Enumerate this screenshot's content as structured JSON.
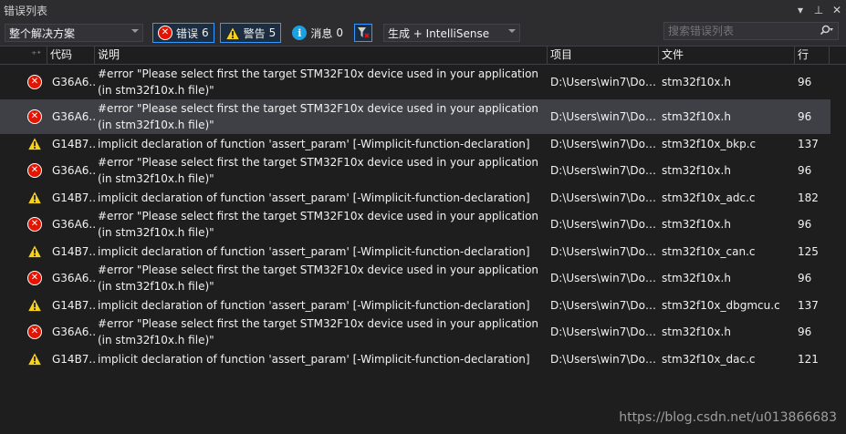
{
  "window": {
    "title": "错误列表",
    "pin_glyph": "▾",
    "pin2_glyph": "⊥",
    "close_glyph": "✕"
  },
  "toolbar": {
    "scope_value": "整个解决方案",
    "errors_label": "错误",
    "errors_count": "6",
    "warnings_label": "警告",
    "warnings_count": "5",
    "messages_label": "消息",
    "messages_count": "0",
    "build_filter_value": "生成 + IntelliSense",
    "search_placeholder": "搜索错误列表"
  },
  "columns": {
    "code": "代码",
    "description": "说明",
    "project": "项目",
    "file": "文件",
    "line": "行"
  },
  "rows": [
    {
      "type": "error",
      "code": "G36A6...",
      "description": "#error \"Please select first the target STM32F10x device used in your application (in stm32f10x.h file)\"",
      "project": "D:\\Users\\win7\\Doc...",
      "file": "stm32f10x.h",
      "line": "96"
    },
    {
      "type": "error",
      "code": "G36A6...",
      "description": "#error \"Please select first the target STM32F10x device used in your application (in stm32f10x.h file)\"",
      "project": "D:\\Users\\win7\\Doc...",
      "file": "stm32f10x.h",
      "line": "96"
    },
    {
      "type": "warning",
      "code": "G14B7...",
      "description": "implicit declaration of function 'assert_param' [-Wimplicit-function-declaration]",
      "project": "D:\\Users\\win7\\Doc...",
      "file": "stm32f10x_bkp.c",
      "line": "137"
    },
    {
      "type": "error",
      "code": "G36A6...",
      "description": "#error \"Please select first the target STM32F10x device used in your application (in stm32f10x.h file)\"",
      "project": "D:\\Users\\win7\\Doc...",
      "file": "stm32f10x.h",
      "line": "96"
    },
    {
      "type": "warning",
      "code": "G14B7...",
      "description": "implicit declaration of function 'assert_param' [-Wimplicit-function-declaration]",
      "project": "D:\\Users\\win7\\Doc...",
      "file": "stm32f10x_adc.c",
      "line": "182"
    },
    {
      "type": "error",
      "code": "G36A6...",
      "description": "#error \"Please select first the target STM32F10x device used in your application (in stm32f10x.h file)\"",
      "project": "D:\\Users\\win7\\Doc...",
      "file": "stm32f10x.h",
      "line": "96"
    },
    {
      "type": "warning",
      "code": "G14B7...",
      "description": "implicit declaration of function 'assert_param' [-Wimplicit-function-declaration]",
      "project": "D:\\Users\\win7\\Doc...",
      "file": "stm32f10x_can.c",
      "line": "125"
    },
    {
      "type": "error",
      "code": "G36A6...",
      "description": "#error \"Please select first the target STM32F10x device used in your application (in stm32f10x.h file)\"",
      "project": "D:\\Users\\win7\\Doc...",
      "file": "stm32f10x.h",
      "line": "96"
    },
    {
      "type": "warning",
      "code": "G14B7...",
      "description": "implicit declaration of function 'assert_param' [-Wimplicit-function-declaration]",
      "project": "D:\\Users\\win7\\Doc...",
      "file": "stm32f10x_dbgmcu.c",
      "line": "137"
    },
    {
      "type": "error",
      "code": "G36A6...",
      "description": "#error \"Please select first the target STM32F10x device used in your application (in stm32f10x.h file)\"",
      "project": "D:\\Users\\win7\\Doc...",
      "file": "stm32f10x.h",
      "line": "96"
    },
    {
      "type": "warning",
      "code": "G14B7...",
      "description": "implicit declaration of function 'assert_param' [-Wimplicit-function-declaration]",
      "project": "D:\\Users\\win7\\Doc...",
      "file": "stm32f10x_dac.c",
      "line": "121"
    }
  ],
  "selected_row": 1,
  "watermark": "https://blog.csdn.net/u013866683",
  "colors": {
    "background": "#1e1e1e",
    "error": "#e51400",
    "warning": "#f8d21a",
    "info": "#1ba1e2",
    "active_border": "#3399ff"
  }
}
